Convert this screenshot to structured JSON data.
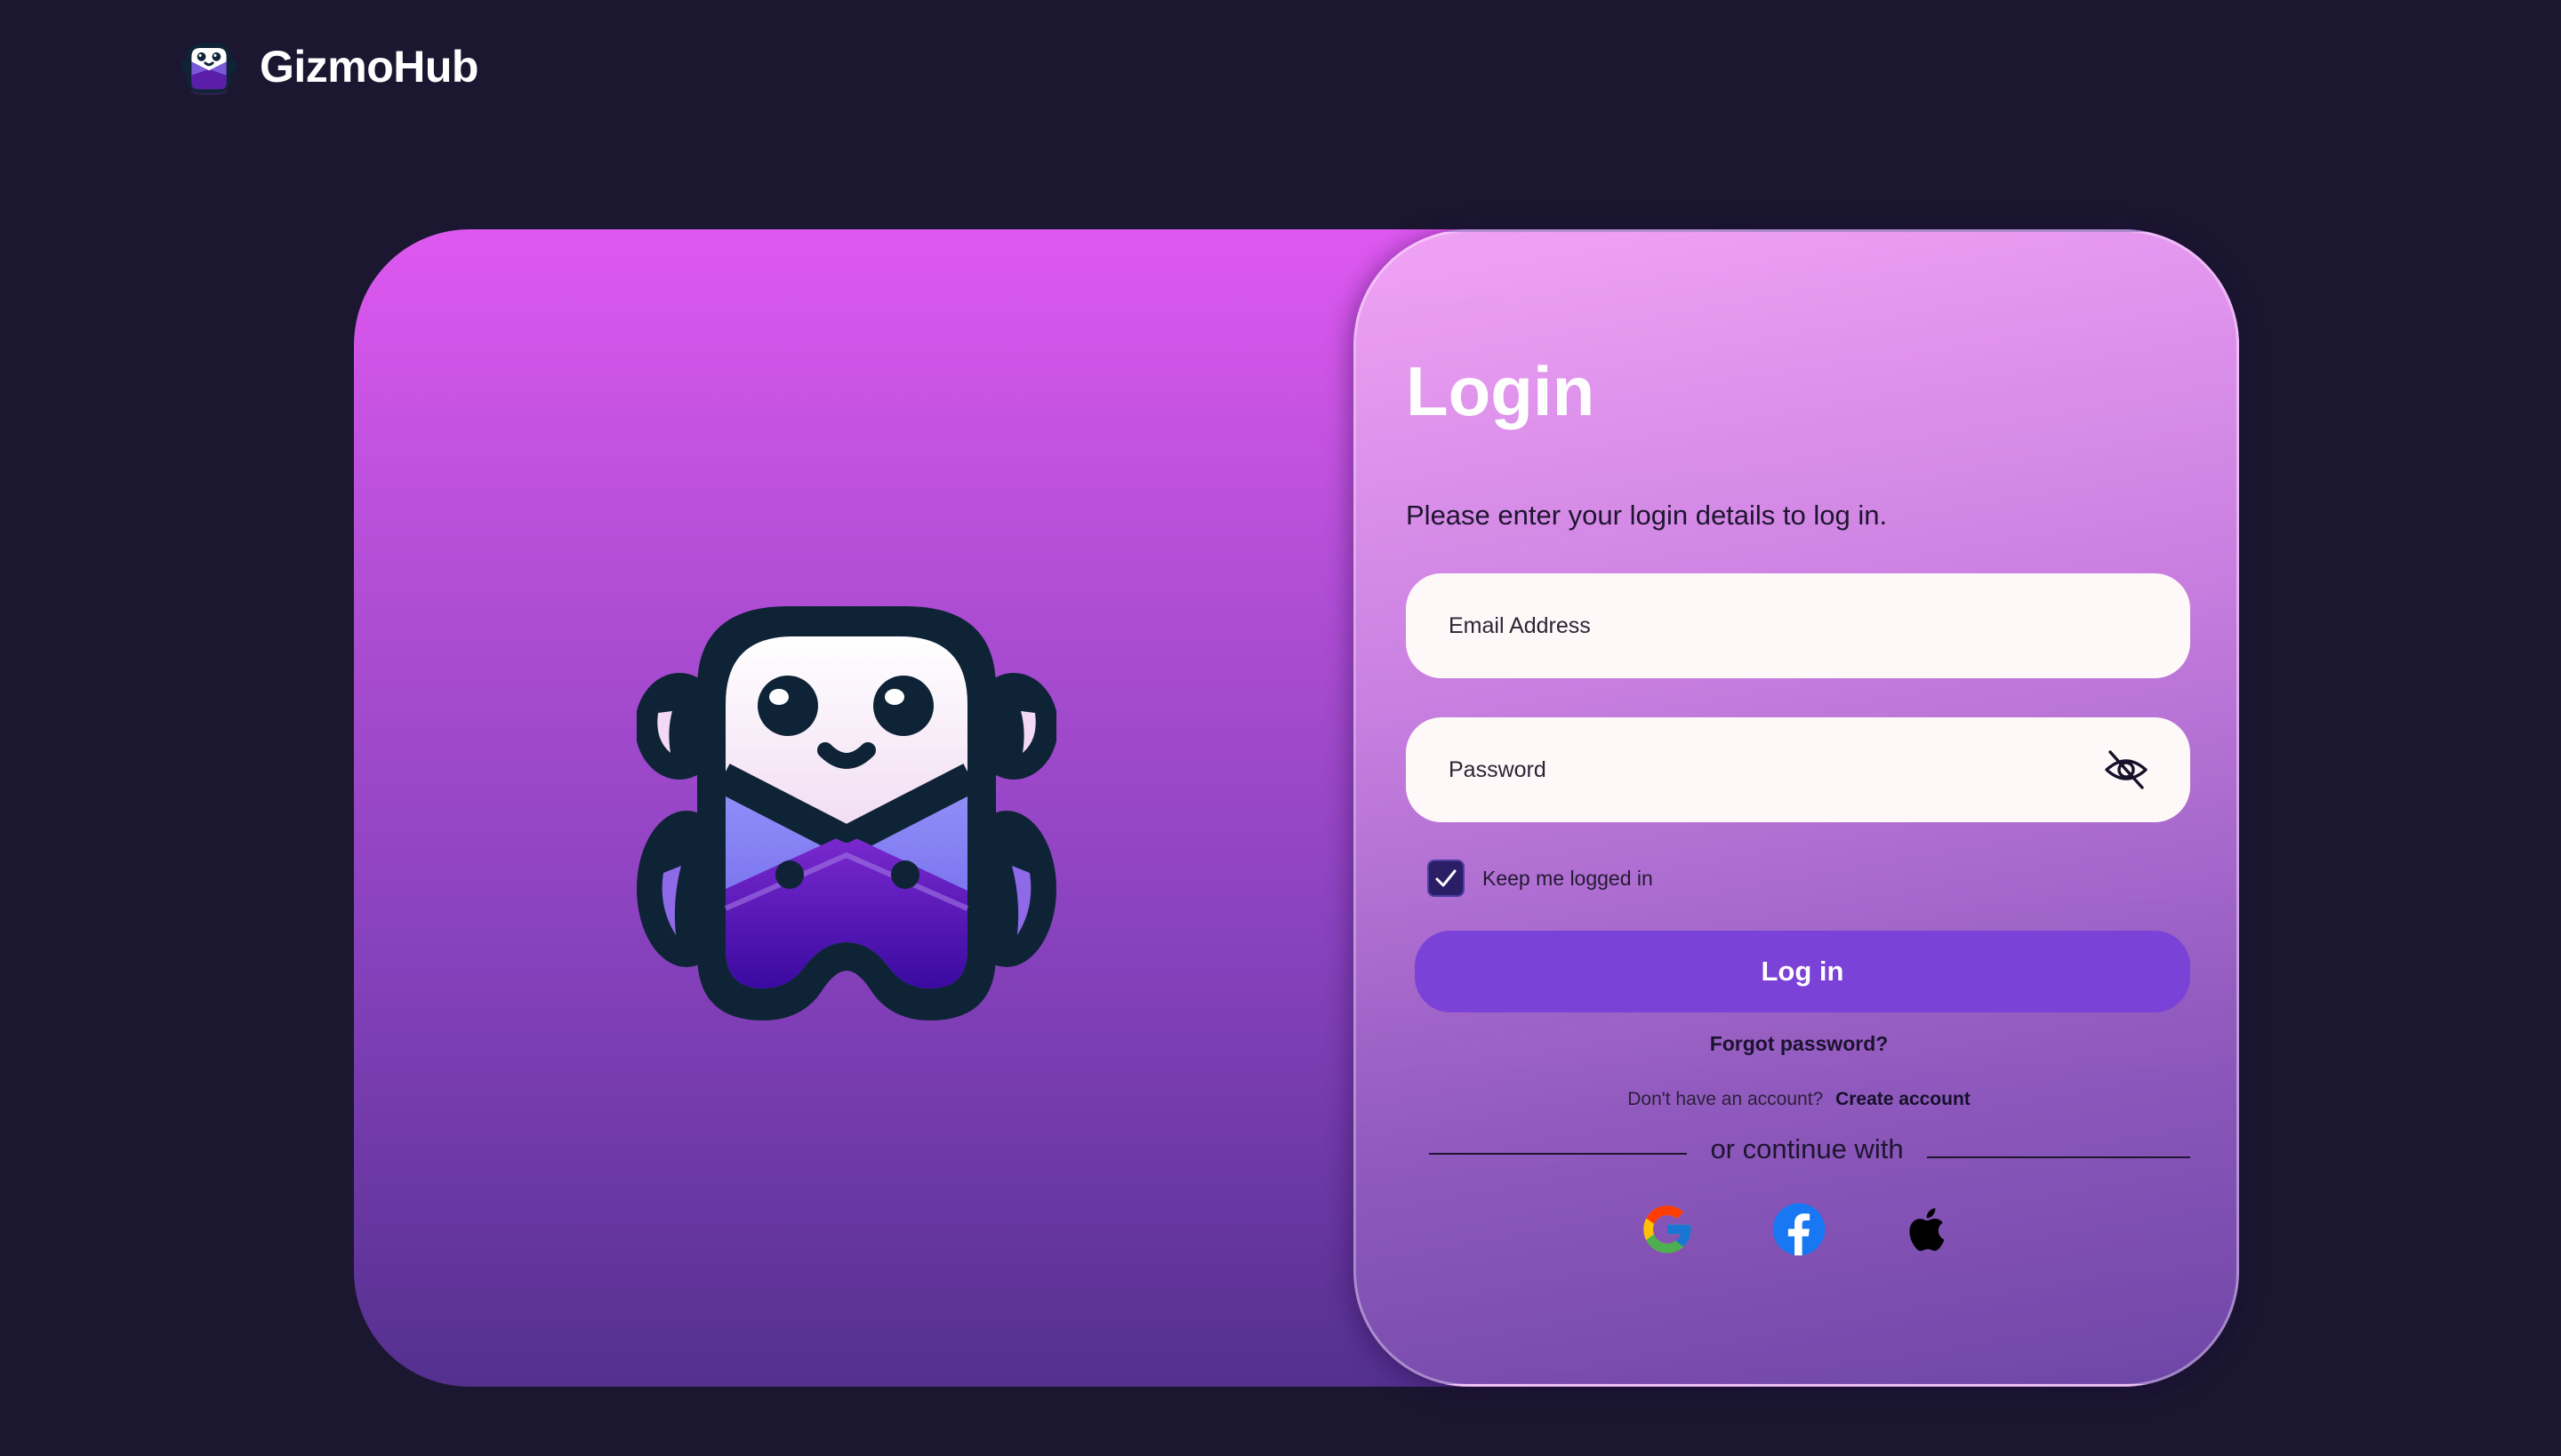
{
  "brand": {
    "name": "GizmoHub",
    "logo_icon": "robot-mascot-logo"
  },
  "hero": {
    "mascot_icon": "robot-mascot"
  },
  "login": {
    "title": "Login",
    "subtitle": "Please enter your login details to log in.",
    "email": {
      "placeholder": "Email Address",
      "value": ""
    },
    "password": {
      "placeholder": "Password",
      "value": "",
      "toggle_icon": "eye-off-icon"
    },
    "remember": {
      "label": "Keep me logged in",
      "checked": true
    },
    "submit_label": "Log in",
    "forgot_label": "Forgot password?",
    "signup_prompt": "Don't have an account?",
    "signup_link": "Create account",
    "divider_text": "or continue with",
    "social": [
      {
        "name": "google",
        "icon": "google-icon"
      },
      {
        "name": "facebook",
        "icon": "facebook-icon"
      },
      {
        "name": "apple",
        "icon": "apple-icon"
      }
    ]
  },
  "colors": {
    "page_bg": "#1b1730",
    "accent": "#7b42d8",
    "checkbox": "#2a1f66",
    "gradient_top": "#de58f0",
    "gradient_bottom": "#54308f"
  }
}
